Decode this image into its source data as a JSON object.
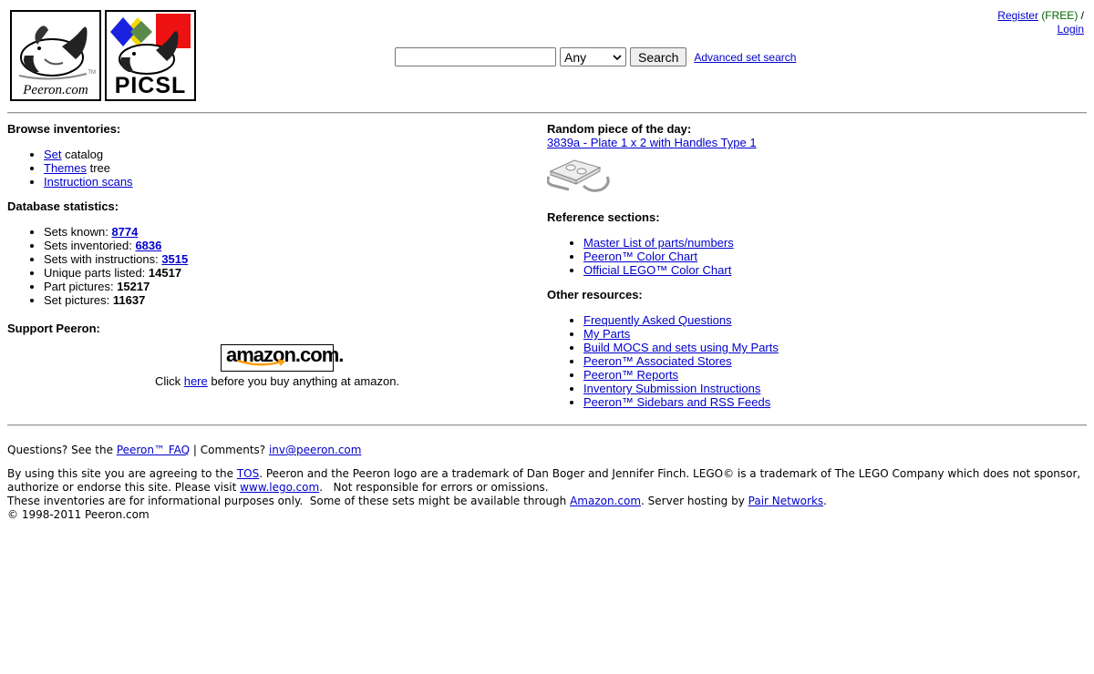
{
  "header": {
    "logos": [
      {
        "name": "peeron-logo",
        "text": "Peeron.com",
        "tm": "TM"
      },
      {
        "name": "picsl-logo",
        "text": "PICSL"
      }
    ],
    "search": {
      "input_value": "",
      "select_value": "Any",
      "button_label": "Search",
      "advanced_link": "Advanced set search"
    },
    "user": {
      "register": "Register",
      "free": "(FREE)",
      "sep": "/",
      "login": "Login"
    }
  },
  "browse": {
    "title": "Browse inventories:",
    "items": [
      {
        "link": "Set",
        "rest": " catalog"
      },
      {
        "link": "Themes",
        "rest": " tree"
      },
      {
        "link": "Instruction scans",
        "rest": ""
      }
    ]
  },
  "stats": {
    "title": "Database statistics:",
    "items": [
      {
        "label": "Sets known: ",
        "value": "8774",
        "linked": true
      },
      {
        "label": "Sets inventoried: ",
        "value": "6836",
        "linked": true
      },
      {
        "label": "Sets with instructions: ",
        "value": "3515",
        "linked": true
      },
      {
        "label": "Unique parts listed: ",
        "value": "14517",
        "linked": false
      },
      {
        "label": "Part pictures: ",
        "value": "15217",
        "linked": false
      },
      {
        "label": "Set pictures: ",
        "value": "11637",
        "linked": false
      }
    ]
  },
  "support": {
    "title": "Support Peeron:",
    "amazon_logo_text": "amazon.com.",
    "click_prefix": "Click ",
    "click_link": "here",
    "click_suffix": " before you buy anything at amazon."
  },
  "random": {
    "title": "Random piece of the day:",
    "link": "3839a - Plate 1 x 2 with Handles Type 1"
  },
  "reference": {
    "title": "Reference sections:",
    "items": [
      "Master List of parts/numbers",
      "Peeron™ Color Chart",
      "Official LEGO™ Color Chart"
    ]
  },
  "other": {
    "title": "Other resources:",
    "items": [
      "Frequently Asked Questions",
      "My Parts",
      "Build MOCS and sets using My Parts",
      "Peeron™ Associated Stores",
      "Peeron™ Reports",
      "Inventory Submission Instructions",
      "Peeron™ Sidebars and RSS Feeds"
    ]
  },
  "footer": {
    "questions": "Questions? See the ",
    "faq_link": "Peeron™ FAQ",
    "comments": " | Comments? ",
    "email": "inv@peeron.com",
    "line1_a": "By using this site you are agreeing to the ",
    "tos": "TOS",
    "line1_b": ". Peeron and the Peeron logo are a trademark of Dan Boger and Jennifer Finch. LEGO© is a trademark of The LEGO Company which does not sponsor, authorize or endorse this site.  Please visit ",
    "lego_link": "www.lego.com",
    "line1_c": ".   Not responsible for errors or omissions.",
    "line2_a": "These inventories are for informational purposes only.  Some of these sets might be available through ",
    "amazon_link": "Amazon.com",
    "line2_b": ". Server hosting by ",
    "pair_link": "Pair Networks",
    "line2_c": ".",
    "copyright": "© 1998-2011 Peeron.com"
  }
}
